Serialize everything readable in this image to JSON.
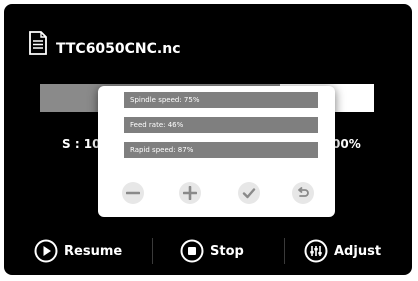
{
  "file": {
    "icon": "document-icon",
    "name": "TTC6050CNC.nc"
  },
  "job": {
    "progress": 0.72,
    "spindle_value_partial": "S : 10",
    "percent_partial": "00%"
  },
  "adjust_dialog": {
    "spindle_speed": "Spindle speed: 75%",
    "feed_rate": "Feed rate: 46%",
    "rapid_speed": "Rapid speed: 87%",
    "buttons": [
      "minus-icon",
      "plus-icon",
      "check-icon",
      "undo-icon"
    ]
  },
  "toolbar": {
    "resume_label": "Resume",
    "stop_label": "Stop",
    "adjust_label": "Adjust"
  },
  "colors": {
    "background": "#000000",
    "dialog": "#ffffff",
    "slider": "#7f7f7f",
    "progress_fill": "#8a8a8a"
  }
}
